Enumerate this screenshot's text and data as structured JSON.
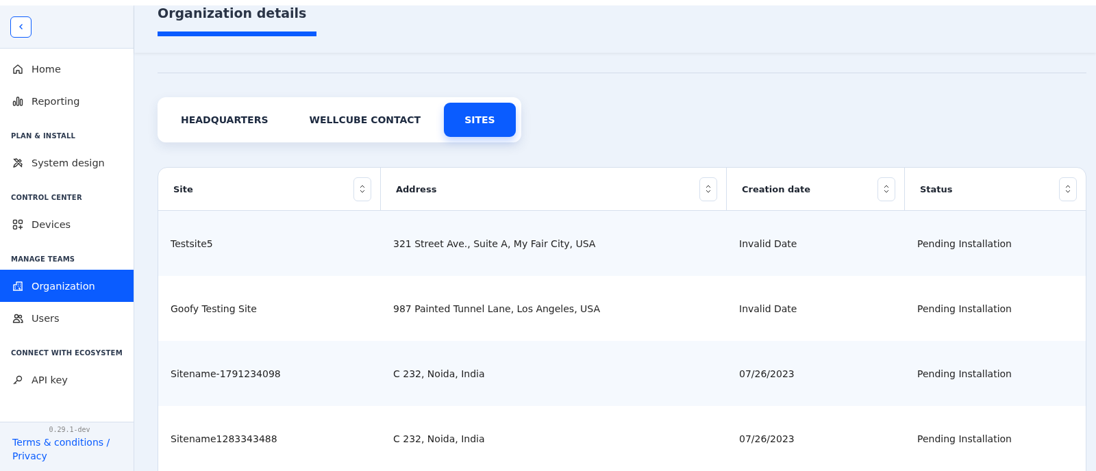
{
  "sidebar": {
    "sections": [
      {
        "items": [
          {
            "label": "Home",
            "kind": "home",
            "selected": false
          },
          {
            "label": "Reporting",
            "kind": "chart",
            "selected": false
          }
        ]
      },
      {
        "heading": "PLAN & INSTALL",
        "items": [
          {
            "label": "System design",
            "kind": "design",
            "selected": false
          }
        ]
      },
      {
        "heading": "CONTROL CENTER",
        "items": [
          {
            "label": "Devices",
            "kind": "devices",
            "selected": false
          }
        ]
      },
      {
        "heading": "MANAGE TEAMS",
        "items": [
          {
            "label": "Organization",
            "kind": "building",
            "selected": true
          },
          {
            "label": "Users",
            "kind": "users",
            "selected": false
          }
        ]
      },
      {
        "heading": "CONNECT WITH ECOSYSTEM",
        "items": [
          {
            "label": "API key",
            "kind": "key",
            "selected": false
          }
        ]
      }
    ],
    "version": "0.29.1-dev",
    "footer_link": "Terms & conditions / Privacy"
  },
  "page_title": "Organization details",
  "tabs": [
    {
      "label": "HEADQUARTERS",
      "selected": false
    },
    {
      "label": "WELLCUBE CONTACT",
      "selected": false
    },
    {
      "label": "SITES",
      "selected": true
    }
  ],
  "table": {
    "columns": [
      "Site",
      "Address",
      "Creation date",
      "Status"
    ],
    "rows": [
      [
        "Testsite5",
        "321 Street Ave., Suite A, My Fair City, USA",
        "Invalid Date",
        "Pending Installation"
      ],
      [
        "Goofy Testing Site",
        "987 Painted Tunnel Lane, Los Angeles, USA",
        "Invalid Date",
        "Pending Installation"
      ],
      [
        "Sitename-1791234098",
        "C 232, Noida, India",
        "07/26/2023",
        "Pending Installation"
      ],
      [
        "Sitename1283343488",
        "C 232, Noida, India",
        "07/26/2023",
        "Pending Installation"
      ]
    ]
  }
}
